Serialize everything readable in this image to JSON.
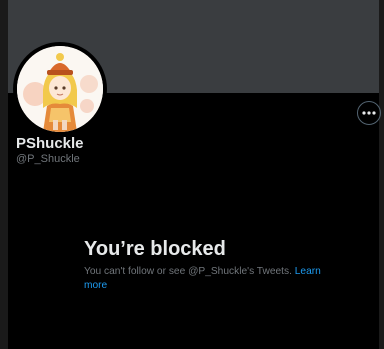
{
  "profile": {
    "display_name": "PShuckle",
    "handle": "@P_Shuckle",
    "avatar_icon": "anime-character-avatar"
  },
  "actions": {
    "more_icon": "more-horizontal-icon"
  },
  "blocked": {
    "title": "You’re blocked",
    "message": "You can't follow or see @P_Shuckle's Tweets.",
    "learn_more": "Learn more"
  },
  "colors": {
    "background": "#000000",
    "banner": "#3a3d40",
    "primary_text": "#e7e9ea",
    "secondary_text": "#71767b",
    "link": "#1d9bf0"
  }
}
